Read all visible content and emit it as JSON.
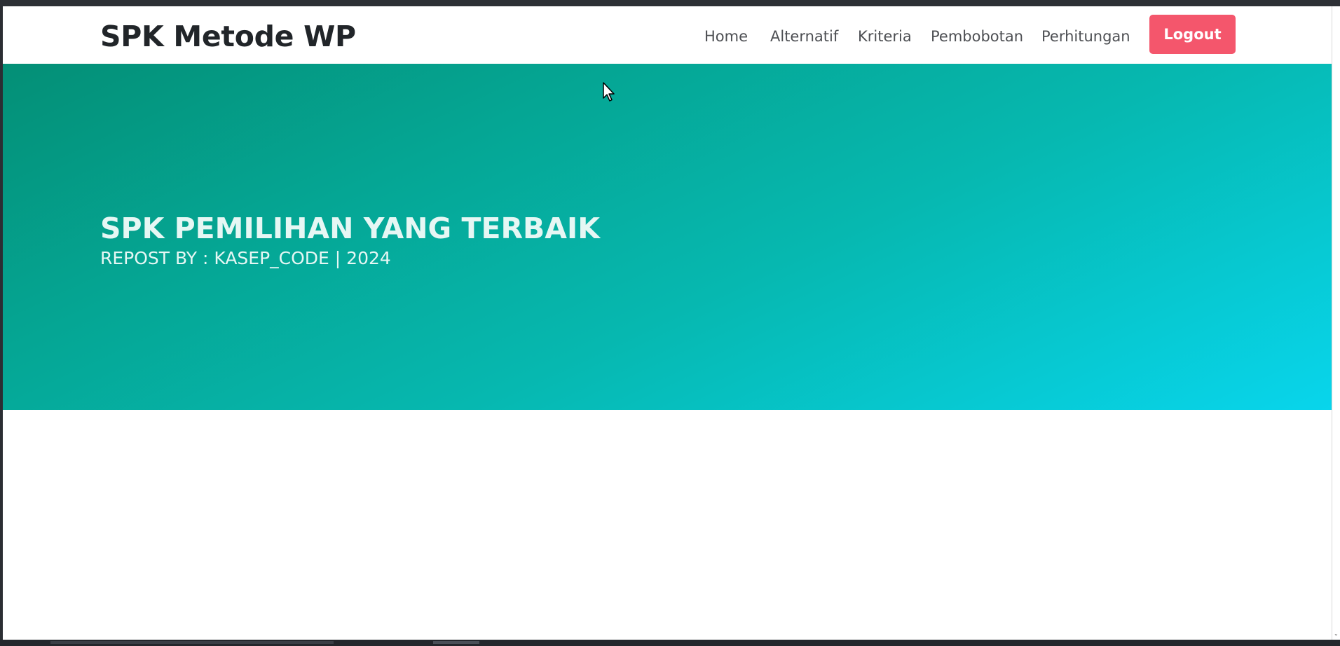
{
  "navbar": {
    "brand": "SPK Metode WP",
    "links": [
      {
        "label": "Home"
      },
      {
        "label": "Alternatif"
      },
      {
        "label": "Kriteria"
      },
      {
        "label": "Pembobotan"
      },
      {
        "label": "Perhitungan"
      }
    ],
    "logout_label": "Logout"
  },
  "hero": {
    "title": "SPK PEMILIHAN YANG TERBAIK",
    "subtitle": "REPOST BY : KASEP_CODE | 2024"
  },
  "colors": {
    "accent_button": "#f4566c",
    "hero_gradient_start": "#048f76",
    "hero_gradient_end": "#08d5ec",
    "text_dark": "#212529"
  },
  "icons": {
    "cursor": "mouse-pointer-icon",
    "scroll_down": "scroll-down-arrow-icon"
  }
}
